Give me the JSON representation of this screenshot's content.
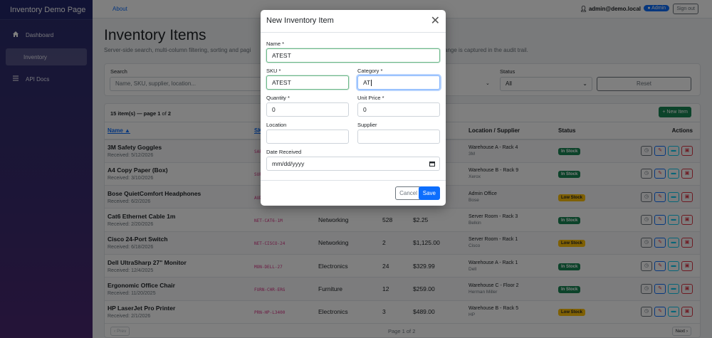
{
  "sidebar": {
    "brand": "Inventory Demo Page",
    "items": [
      {
        "label": "Dashboard",
        "icon": "home-icon"
      },
      {
        "label": "Inventory",
        "icon": ""
      },
      {
        "label": "API Docs",
        "icon": "list-icon"
      }
    ]
  },
  "topbar": {
    "about": "About",
    "user": "admin@demo.local",
    "role_badge": "Admin",
    "signout": "Sign out"
  },
  "page": {
    "title": "Inventory Items",
    "subtitle_left": "Server-side search, multi-column filtering, sorting and pagi",
    "subtitle_right": "ange is captured in the audit trail."
  },
  "filters": {
    "search_label": "Search",
    "search_placeholder": "Name, SKU, supplier, location...",
    "status_label": "Status",
    "status_value": "All",
    "reset_label": "Reset"
  },
  "table": {
    "count_text_prefix": "15 item(s) — page ",
    "page": "1",
    "count_mid": " of ",
    "pages": "2",
    "new_button": "+ New Item",
    "columns": {
      "name": "Name ▲",
      "sku": "SK",
      "location": "Location / Supplier",
      "status": "Status",
      "actions": "Actions"
    },
    "rows": [
      {
        "name": "3M Safety Goggles",
        "received": "Received: 5/12/2026",
        "sku": "SAF",
        "category": "",
        "qty": "",
        "price": "",
        "location": "Warehouse A - Rack 4",
        "supplier": "3M",
        "status": "In Stock"
      },
      {
        "name": "A4 Copy Paper (Box)",
        "received": "Received: 3/10/2026",
        "sku": "SUP",
        "category": "",
        "qty": "",
        "price": "",
        "location": "Warehouse B - Rack 9",
        "supplier": "Xerox",
        "status": "In Stock"
      },
      {
        "name": "Bose QuietComfort Headphones",
        "received": "Received: 6/2/2026",
        "sku": "AUD",
        "category": "",
        "qty": "",
        "price": "",
        "location": "Admin Office",
        "supplier": "Bose",
        "status": "Low Stock"
      },
      {
        "name": "Cat6 Ethernet Cable 1m",
        "received": "Received: 2/20/2026",
        "sku": "NET-CAT6-1M",
        "category": "Networking",
        "qty": "528",
        "price": "$2.25",
        "location": "Server Room - Rack 3",
        "supplier": "Belkin",
        "status": "In Stock"
      },
      {
        "name": "Cisco 24-Port Switch",
        "received": "Received: 6/18/2026",
        "sku": "NET-CISCO-24",
        "category": "Networking",
        "qty": "2",
        "price": "$1,125.00",
        "location": "Server Room - Rack 1",
        "supplier": "Cisco",
        "status": "Low Stock"
      },
      {
        "name": "Dell UltraSharp 27\" Monitor",
        "received": "Received: 12/4/2025",
        "sku": "MON-DELL-27",
        "category": "Electronics",
        "qty": "24",
        "price": "$329.99",
        "location": "Warehouse A - Rack 1",
        "supplier": "Dell",
        "status": "In Stock"
      },
      {
        "name": "Ergonomic Office Chair",
        "received": "Received: 11/20/2025",
        "sku": "FURN-CHR-ERG",
        "category": "Furniture",
        "qty": "12",
        "price": "$259.00",
        "location": "Warehouse C - Floor 2",
        "supplier": "Herman Miller",
        "status": "In Stock"
      },
      {
        "name": "HP LaserJet Pro Printer",
        "received": "Received: 2/1/2026",
        "sku": "PRN-HP-L3400",
        "category": "Electronics",
        "qty": "3",
        "price": "$489.00",
        "location": "Warehouse B - Rack 5",
        "supplier": "HP",
        "status": "Low Stock"
      }
    ],
    "pager": {
      "prev": "‹ Prev",
      "info": "Page 1 of 2",
      "next": "Next ›"
    }
  },
  "modal": {
    "title": "New Inventory Item",
    "close_icon": "close-icon",
    "name_label": "Name *",
    "name_value": "ATEST",
    "sku_label": "SKU *",
    "sku_value": "ATEST",
    "category_label": "Category *",
    "category_value": "AT",
    "quantity_label": "Quantity *",
    "quantity_value": "0",
    "price_label": "Unit Price *",
    "price_value": "0",
    "location_label": "Location",
    "location_value": "",
    "supplier_label": "Supplier",
    "supplier_value": "",
    "date_label": "Date Received",
    "date_placeholder": "mm/dd/yyyy",
    "cancel": "Cancel",
    "save": "Save"
  },
  "colors": {
    "primary": "#0d6efd",
    "success": "#198754",
    "warning": "#ffc107",
    "danger": "#dc3545"
  }
}
